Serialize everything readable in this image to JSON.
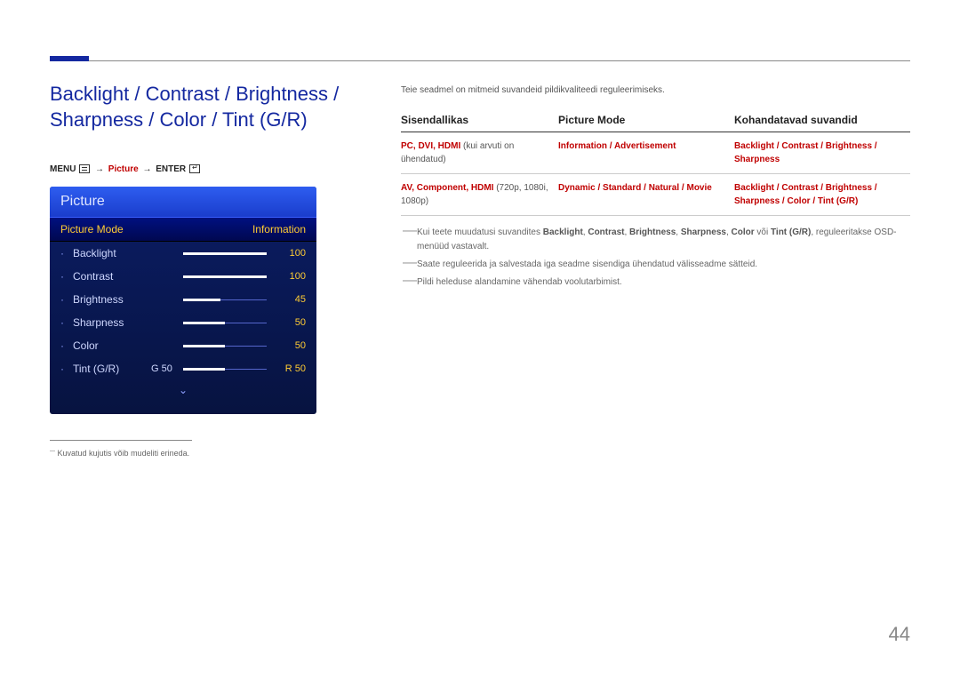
{
  "page_number": "44",
  "title": "Backlight / Contrast / Brightness / Sharpness / Color / Tint (G/R)",
  "breadcrumb": {
    "menu": "MENU",
    "picture": "Picture",
    "enter": "ENTER"
  },
  "osd": {
    "header": "Picture",
    "selected_label": "Picture Mode",
    "selected_value": "Information",
    "rows": [
      {
        "label": "Backlight",
        "value": "100",
        "fill": 100
      },
      {
        "label": "Contrast",
        "value": "100",
        "fill": 100
      },
      {
        "label": "Brightness",
        "value": "45",
        "fill": 45
      },
      {
        "label": "Sharpness",
        "value": "50",
        "fill": 50
      },
      {
        "label": "Color",
        "value": "50",
        "fill": 50
      },
      {
        "label": "Tint (G/R)",
        "extra": "G 50",
        "value": "R 50",
        "fill": 50
      }
    ]
  },
  "footnote": "Kuvatud kujutis võib mudeliti erineda.",
  "intro": "Teie seadmel on mitmeid suvandeid pildikvaliteedi reguleerimiseks.",
  "table": {
    "headers": {
      "c1": "Sisendallikas",
      "c2": "Picture Mode",
      "c3": "Kohandatavad suvandid"
    },
    "rows": [
      {
        "c1_red": "PC, DVI, HDMI",
        "c1_plain": " (kui arvuti on ühendatud)",
        "c2_red": "Information / Advertisement",
        "c3_red": "Backlight / Contrast / Brightness / Sharpness"
      },
      {
        "c1_red": "AV, Component, HDMI",
        "c1_plain": " (720p, 1080i, 1080p)",
        "c2_red": "Dynamic / Standard / Natural / Movie",
        "c3_red": "Backlight / Contrast / Brightness / Sharpness / Color / Tint (G/R)"
      }
    ]
  },
  "notes": {
    "n1_pre": "Kui teete muudatusi suvandites ",
    "n1_b1": "Backlight",
    "n1_b2": "Contrast",
    "n1_b3": "Brightness",
    "n1_b4": "Sharpness",
    "n1_b5": "Color",
    "n1_mid": " või ",
    "n1_b6": "Tint (G/R)",
    "n1_post": ", reguleeritakse OSD-menüüd vastavalt.",
    "n2": "Saate reguleerida ja salvestada iga seadme sisendiga ühendatud välisseadme sätteid.",
    "n3": "Pildi heleduse alandamine vähendab voolutarbimist."
  }
}
